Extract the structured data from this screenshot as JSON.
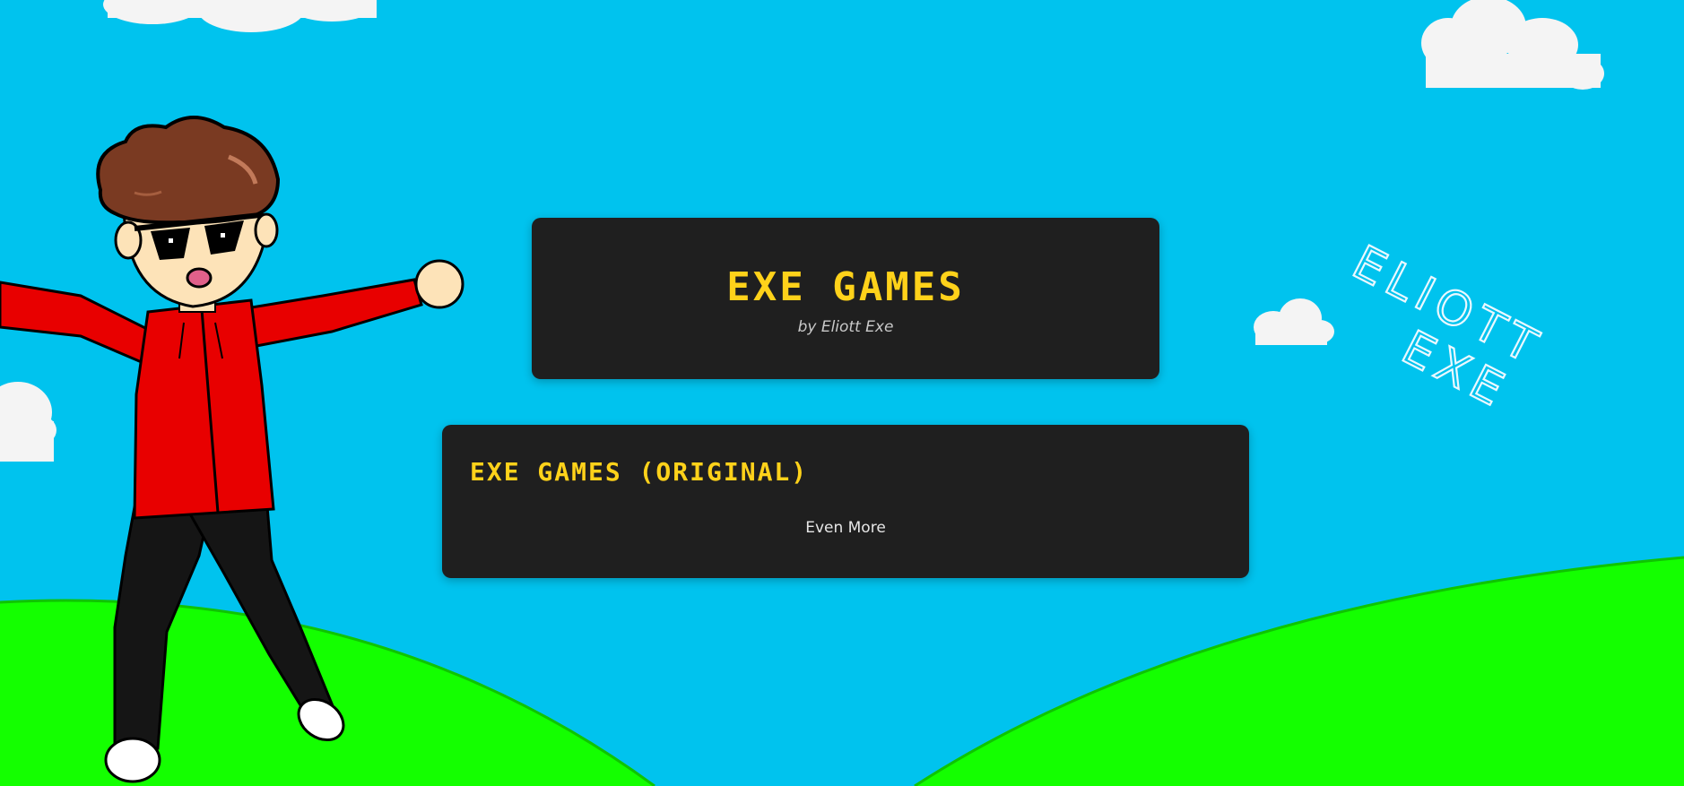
{
  "header": {
    "title": "EXE GAMES",
    "byline": "by Eliott Exe"
  },
  "games_section": {
    "title": "EXE GAMES (ORIGINAL)",
    "more_link": "Even More"
  },
  "background": {
    "sky_color": "#00c3ee",
    "grass_color": "#14ff00",
    "card_color": "#1f1f1f",
    "accent_color": "#ffd21a",
    "sky_scribble": [
      "ELIOTT",
      "EXE"
    ],
    "mascot": "pixel-art-boy-with-sunglasses-red-hoodie"
  }
}
